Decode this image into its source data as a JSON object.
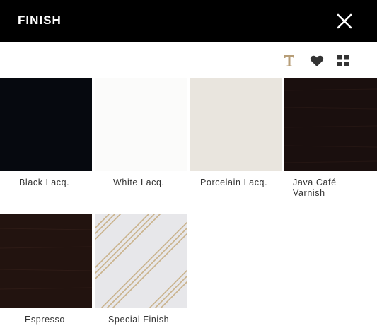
{
  "header": {
    "title": "FINISH",
    "close_icon": "close-icon"
  },
  "toolbar": {
    "icons": [
      "text-t-icon",
      "heart-icon",
      "grid-icon"
    ],
    "accent_color": "#b79e78",
    "icon_color": "#333333"
  },
  "finishes": [
    {
      "label": "Black Lacq.",
      "color": "#05070c"
    },
    {
      "label": "White Lacq.",
      "color": "#f7f6f4"
    },
    {
      "label": "Porcelain Lacq.",
      "color": "#e9e5de"
    },
    {
      "label": "Java Café",
      "label_line2": "Varnish",
      "color": "#1a0f0e"
    },
    {
      "label": "Espresso",
      "color": "#22130f"
    },
    {
      "label": "Special Finish",
      "color": "#e7e7ea",
      "pattern": "diagonal-stripes"
    }
  ]
}
